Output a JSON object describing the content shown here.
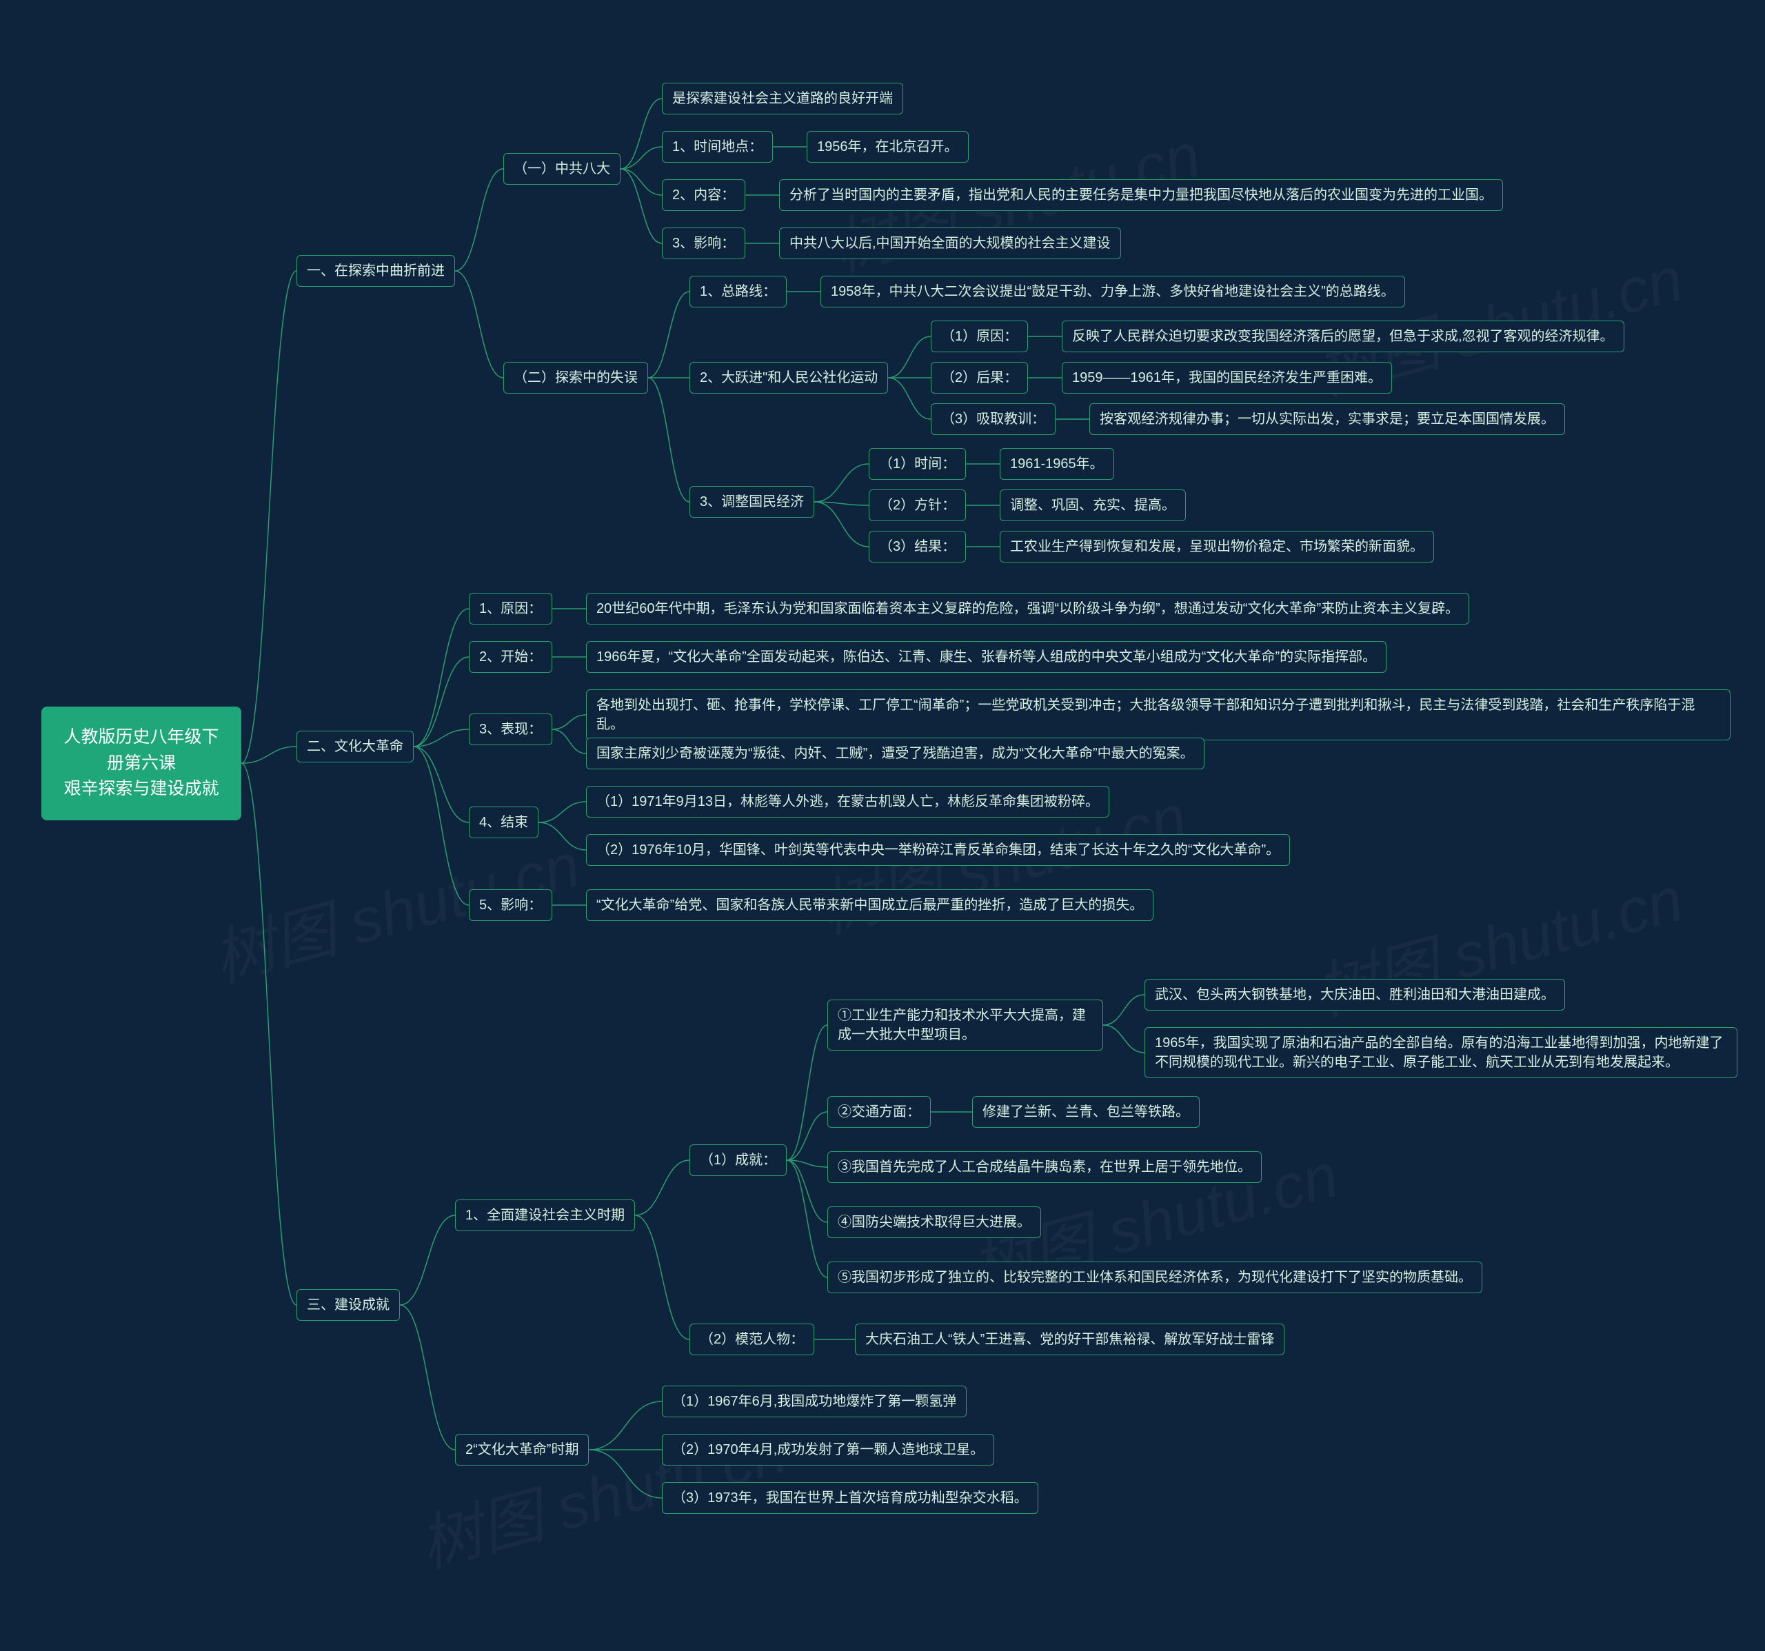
{
  "root": {
    "title_line1": "人教版历史八年级下册第六课",
    "title_line2": "艰辛探索与建设成就"
  },
  "s1": {
    "title": "一、在探索中曲折前进",
    "a": {
      "title": "（一）中共八大",
      "a0": "是探索建设社会主义道路的良好开端",
      "a1": {
        "label": "1、时间地点：",
        "value": "1956年，在北京召开。"
      },
      "a2": {
        "label": "2、内容：",
        "value": "分析了当时国内的主要矛盾，指出党和人民的主要任务是集中力量把我国尽快地从落后的农业国变为先进的工业国。"
      },
      "a3": {
        "label": "3、影响：",
        "value": "中共八大以后,中国开始全面的大规模的社会主义建设"
      }
    },
    "b": {
      "title": "（二）探索中的失误",
      "b1": {
        "label": "1、总路线：",
        "value": "1958年，中共八大二次会议提出“鼓足干劲、力争上游、多快好省地建设社会主义”的总路线。"
      },
      "b2": {
        "label": "2、大跃进\"和人民公社化运动",
        "r1": {
          "label": "（1）原因：",
          "value": "反映了人民群众迫切要求改变我国经济落后的愿望，但急于求成,忽视了客观的经济规律。"
        },
        "r2": {
          "label": "（2）后果：",
          "value": "1959——1961年，我国的国民经济发生严重困难。"
        },
        "r3": {
          "label": "（3）吸取教训：",
          "value": "按客观经济规律办事；一切从实际出发，实事求是；要立足本国国情发展。"
        }
      },
      "b3": {
        "label": "3、调整国民经济",
        "r1": {
          "label": "（1）时间：",
          "value": "1961-1965年。"
        },
        "r2": {
          "label": "（2）方针：",
          "value": "调整、巩固、充实、提高。"
        },
        "r3": {
          "label": "（3）结果：",
          "value": "工农业生产得到恢复和发展，呈现出物价稳定、市场繁荣的新面貌。"
        }
      }
    }
  },
  "s2": {
    "title": "二、文化大革命",
    "c1": {
      "label": "1、原因：",
      "value": "20世纪60年代中期，毛泽东认为党和国家面临着资本主义复辟的危险，强调“以阶级斗争为纲”，想通过发动“文化大革命”来防止资本主义复辟。"
    },
    "c2": {
      "label": "2、开始：",
      "value": "1966年夏，“文化大革命”全面发动起来，陈伯达、江青、康生、张春桥等人组成的中央文革小组成为“文化大革命”的实际指挥部。"
    },
    "c3": {
      "label": "3、表现：",
      "v1": "各地到处出现打、砸、抢事件，学校停课、工厂停工“闹革命”；一些党政机关受到冲击；大批各级领导干部和知识分子遭到批判和揪斗，民主与法律受到践踏，社会和生产秩序陷于混乱。",
      "v2": "国家主席刘少奇被诬蔑为“叛徒、内奸、工贼”，遭受了残酷迫害，成为“文化大革命”中最大的冤案。"
    },
    "c4": {
      "label": "4、结束",
      "v1": "（1）1971年9月13日，林彪等人外逃，在蒙古机毁人亡，林彪反革命集团被粉碎。",
      "v2": "（2）1976年10月，华国锋、叶剑英等代表中央一举粉碎江青反革命集团，结束了长达十年之久的“文化大革命”。"
    },
    "c5": {
      "label": "5、影响：",
      "value": "“文化大革命”给党、国家和各族人民带来新中国成立后最严重的挫折，造成了巨大的损失。"
    }
  },
  "s3": {
    "title": "三、建设成就",
    "d1": {
      "label": "1、全面建设社会主义时期",
      "r1": {
        "label": "（1）成就：",
        "i1": {
          "label": "①工业生产能力和技术水平大大提高，建成一大批大中型项目。",
          "v1": "武汉、包头两大钢铁基地，大庆油田、胜利油田和大港油田建成。",
          "v2": "1965年，我国实现了原油和石油产品的全部自给。原有的沿海工业基地得到加强，内地新建了不同规模的现代工业。新兴的电子工业、原子能工业、航天工业从无到有地发展起来。"
        },
        "i2": {
          "label": "②交通方面：",
          "value": "修建了兰新、兰青、包兰等铁路。"
        },
        "i3": "③我国首先完成了人工合成结晶牛胰岛素，在世界上居于领先地位。",
        "i4": "④国防尖端技术取得巨大进展。",
        "i5": "⑤我国初步形成了独立的、比较完整的工业体系和国民经济体系，为现代化建设打下了坚实的物质基础。"
      },
      "r2": {
        "label": "（2）模范人物：",
        "value": "大庆石油工人“铁人”王进喜、党的好干部焦裕禄、解放军好战士雷锋"
      }
    },
    "d2": {
      "label": "2“文化大革命”时期",
      "v1": "（1）1967年6月,我国成功地爆炸了第一颗氢弹",
      "v2": "（2）1970年4月,成功发射了第一颗人造地球卫星。",
      "v3": "（3）1973年，我国在世界上首次培育成功籼型杂交水稻。"
    }
  },
  "watermark": "树图 shutu.cn"
}
